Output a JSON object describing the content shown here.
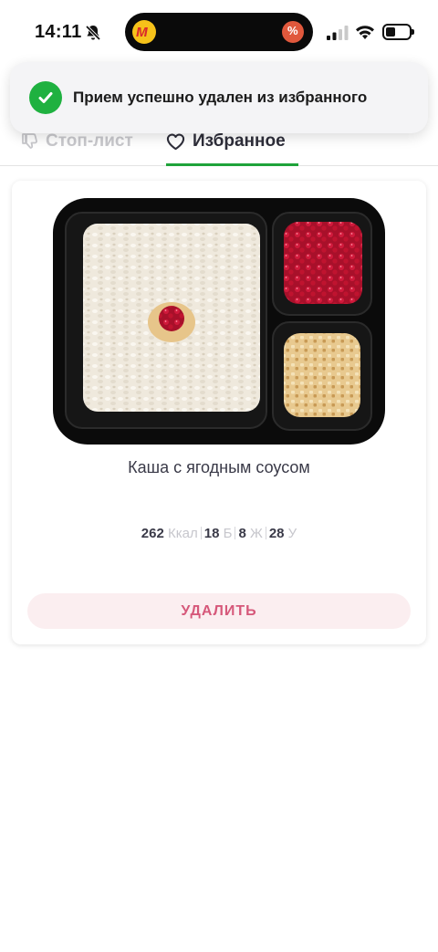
{
  "status_bar": {
    "time": "14:11",
    "icons": [
      "bell-slash-icon",
      "app-icon-yellow",
      "app-icon-discount",
      "cellular-signal-icon",
      "wifi-icon",
      "battery-icon"
    ],
    "discount_glyph": "%",
    "app_glyph": "м"
  },
  "toast": {
    "message": "Прием успешно удален из избранного",
    "icon": "check-circle-icon",
    "color": "#1fb140"
  },
  "tabs": {
    "items": [
      {
        "label": "Стоп-лист",
        "icon": "thumbs-down-icon",
        "active": false
      },
      {
        "label": "Избранное",
        "icon": "heart-icon",
        "active": true
      }
    ],
    "active_color": "#1fa33a"
  },
  "card": {
    "image": "porridge-with-berry-sauce-photo",
    "title": "Каша с ягодным соусом",
    "nutrition": {
      "kcal": {
        "value": "262",
        "unit": "Ккал"
      },
      "protein": {
        "value": "18",
        "unit": "Б"
      },
      "fat": {
        "value": "8",
        "unit": "Ж"
      },
      "carbs": {
        "value": "28",
        "unit": "У"
      }
    },
    "delete_label": "УДАЛИТЬ"
  }
}
